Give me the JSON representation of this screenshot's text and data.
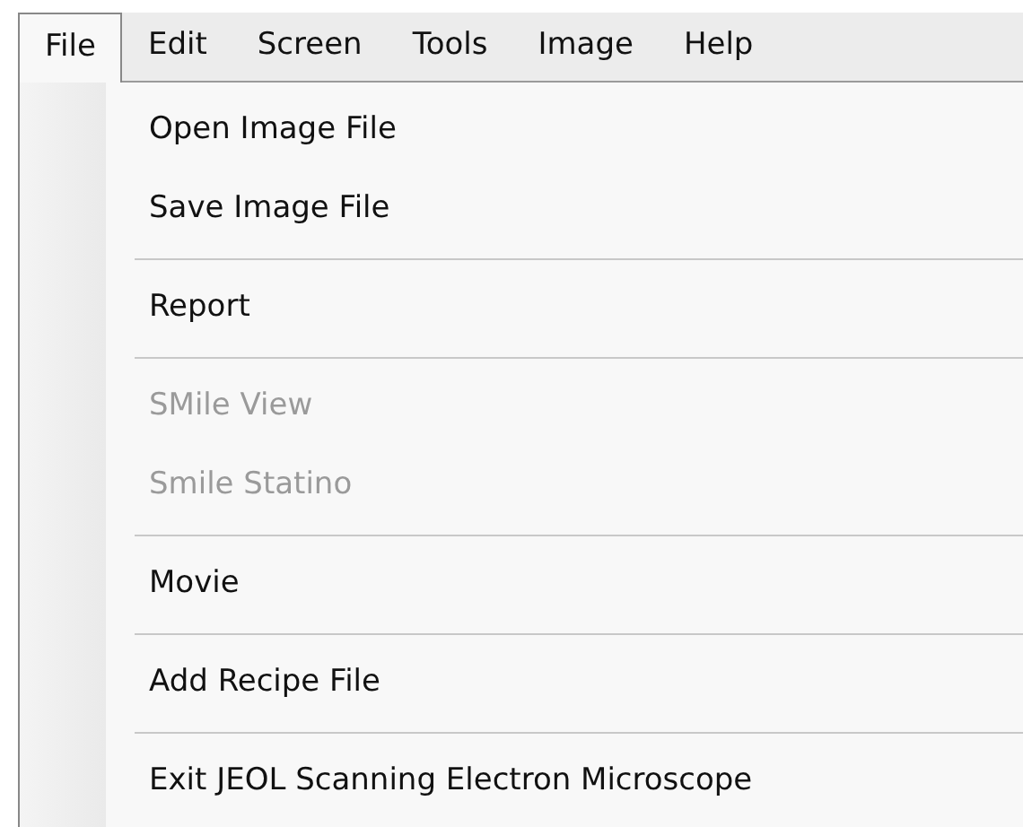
{
  "menu_bar": [
    {
      "label": "File",
      "selected": true
    },
    {
      "label": "Edit",
      "selected": false
    },
    {
      "label": "Screen",
      "selected": false
    },
    {
      "label": "Tools",
      "selected": false
    },
    {
      "label": "Image",
      "selected": false
    },
    {
      "label": "Help",
      "selected": false
    }
  ],
  "menu": [
    {
      "kind": "item",
      "label": "Open Image File",
      "disabled": false
    },
    {
      "kind": "item",
      "label": "Save Image File",
      "disabled": false
    },
    {
      "kind": "separator"
    },
    {
      "kind": "item",
      "label": "Report",
      "disabled": false
    },
    {
      "kind": "separator"
    },
    {
      "kind": "item",
      "label": "SMile View",
      "disabled": true
    },
    {
      "kind": "item",
      "label": "Smile Statino",
      "disabled": true
    },
    {
      "kind": "separator"
    },
    {
      "kind": "item",
      "label": "Movie",
      "disabled": false
    },
    {
      "kind": "separator"
    },
    {
      "kind": "item",
      "label": "Add Recipe File",
      "disabled": false
    },
    {
      "kind": "separator"
    },
    {
      "kind": "item",
      "label": "Exit JEOL Scanning Electron Microscope",
      "disabled": false
    }
  ]
}
